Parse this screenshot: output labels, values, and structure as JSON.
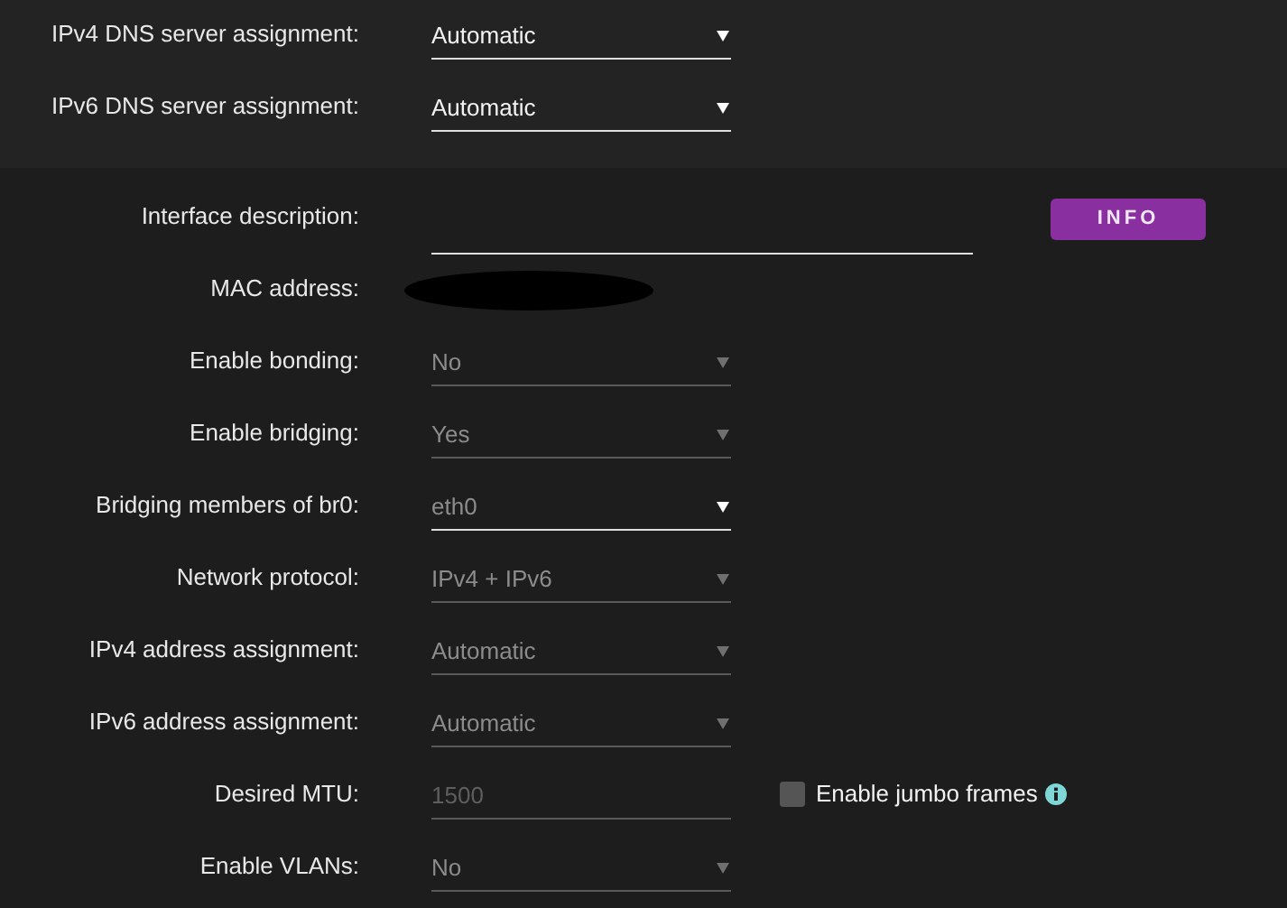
{
  "dns_section": [
    {
      "label": "IPv4 DNS server assignment:",
      "kind": "select",
      "value": "Automatic",
      "disabled": false
    },
    {
      "label": "IPv6 DNS server assignment:",
      "kind": "select",
      "value": "Automatic",
      "disabled": false
    }
  ],
  "interface_section": [
    {
      "label": "Interface description:",
      "kind": "text",
      "button": "INFO"
    },
    {
      "label": "MAC address:",
      "kind": "redacted"
    },
    {
      "label": "Enable bonding:",
      "kind": "select",
      "value": "No",
      "disabled": true
    },
    {
      "label": "Enable bridging:",
      "kind": "select",
      "value": "Yes",
      "disabled": true
    },
    {
      "label": "Bridging members of br0:",
      "kind": "select",
      "value": "eth0",
      "disabled": false
    },
    {
      "label": "Network protocol:",
      "kind": "select",
      "value": "IPv4 + IPv6",
      "disabled": true
    },
    {
      "label": "IPv4 address assignment:",
      "kind": "select",
      "value": "Automatic",
      "disabled": true
    },
    {
      "label": "IPv6 address assignment:",
      "kind": "select",
      "value": "Automatic",
      "disabled": true
    },
    {
      "label": "Desired MTU:",
      "kind": "number",
      "value": "1500",
      "disabled": true,
      "checkbox": {
        "label": "Enable jumbo frames",
        "checked": false
      }
    },
    {
      "label": "Enable VLANs:",
      "kind": "select",
      "value": "No",
      "disabled": true
    }
  ]
}
